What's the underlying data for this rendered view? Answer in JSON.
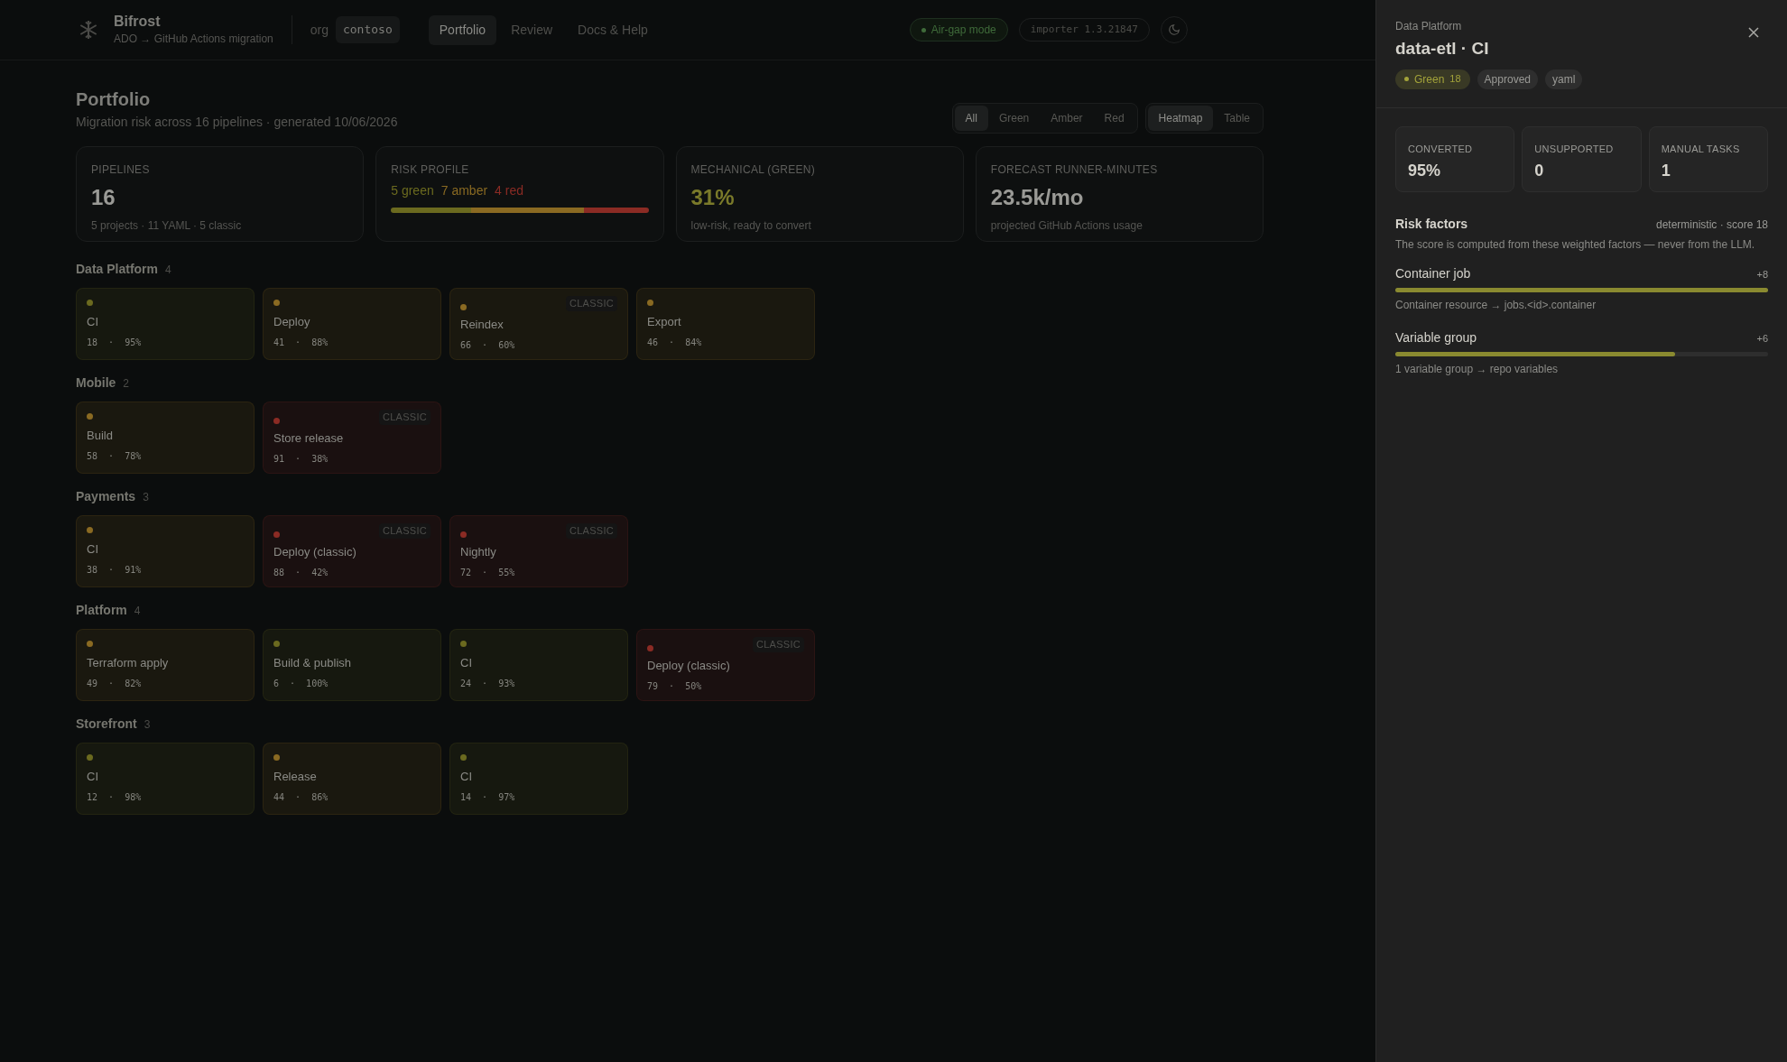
{
  "header": {
    "brand": "Bifrost",
    "subtitle": "ADO → GitHub Actions migration",
    "org_label": "org",
    "org": "contoso",
    "nav": [
      {
        "label": "Portfolio",
        "selected": true
      },
      {
        "label": "Review",
        "selected": false
      },
      {
        "label": "Docs & Help",
        "selected": false
      }
    ],
    "mode_badge": "Air-gap mode",
    "version": "importer 1.3.21847"
  },
  "page": {
    "title": "Portfolio",
    "subtitle": "Migration risk across 16 pipelines · generated 10/06/2026",
    "filters": [
      {
        "label": "All",
        "selected": true
      },
      {
        "label": "Green",
        "selected": false
      },
      {
        "label": "Amber",
        "selected": false
      },
      {
        "label": "Red",
        "selected": false
      }
    ],
    "views": [
      {
        "label": "Heatmap",
        "selected": true
      },
      {
        "label": "Table",
        "selected": false
      }
    ]
  },
  "kpis": [
    {
      "kind": "stat",
      "label": "PIPELINES",
      "value": "16",
      "note": "5 projects · 11 YAML · 5 classic"
    },
    {
      "kind": "profile",
      "label": "RISK PROFILE",
      "segments": [
        {
          "label": "5 green",
          "color": "#6b6a1f"
        },
        {
          "label": "7 amber",
          "color": "#8a6a22"
        },
        {
          "label": "4 red",
          "color": "#8b2b24"
        }
      ]
    },
    {
      "kind": "stat",
      "label": "MECHANICAL (GREEN)",
      "value": "31%",
      "note": "low-risk, ready to convert",
      "color": "#7a7a2a"
    },
    {
      "kind": "stat",
      "label": "FORECAST RUNNER-MINUTES",
      "value": "23.5k/mo",
      "note": "projected GitHub Actions usage"
    }
  ],
  "groups": [
    {
      "name": "Data Platform",
      "count": "4",
      "pipelines": [
        {
          "name": "CI",
          "meta": "18 · 95%",
          "color": "#6b6a1f"
        },
        {
          "name": "Deploy",
          "meta": "41 · 88%",
          "color": "#8a6a22"
        },
        {
          "name": "Reindex",
          "meta": "66 · 60%",
          "color": "#8a6a22",
          "tag": "CLASSIC"
        },
        {
          "name": "Export",
          "meta": "46 · 84%",
          "color": "#8a6a22"
        }
      ]
    },
    {
      "name": "Mobile",
      "count": "2",
      "pipelines": [
        {
          "name": "Build",
          "meta": "58 · 78%",
          "color": "#8a6a22"
        },
        {
          "name": "Store release",
          "meta": "91 · 38%",
          "color": "#8b2b24",
          "tag": "CLASSIC"
        }
      ]
    },
    {
      "name": "Payments",
      "count": "3",
      "pipelines": [
        {
          "name": "CI",
          "meta": "38 · 91%",
          "color": "#8a6a22"
        },
        {
          "name": "Deploy (classic)",
          "meta": "88 · 42%",
          "color": "#8b2b24",
          "tag": "CLASSIC"
        },
        {
          "name": "Nightly",
          "meta": "72 · 55%",
          "color": "#8b2b24",
          "tag": "CLASSIC"
        }
      ]
    },
    {
      "name": "Platform",
      "count": "4",
      "pipelines": [
        {
          "name": "Terraform apply",
          "meta": "49 · 82%",
          "color": "#8a6a22"
        },
        {
          "name": "Build & publish",
          "meta": "6 · 100%",
          "color": "#6b6a1f"
        },
        {
          "name": "CI",
          "meta": "24 · 93%",
          "color": "#6b6a1f"
        },
        {
          "name": "Deploy (classic)",
          "meta": "79 · 50%",
          "color": "#8b2b24",
          "tag": "CLASSIC"
        }
      ]
    },
    {
      "name": "Storefront",
      "count": "3",
      "pipelines": [
        {
          "name": "CI",
          "meta": "12 · 98%",
          "color": "#6b6a1f"
        },
        {
          "name": "Release",
          "meta": "44 · 86%",
          "color": "#8a6a22"
        },
        {
          "name": "CI",
          "meta": "14 · 97%",
          "color": "#6b6a1f"
        }
      ]
    }
  ],
  "panel": {
    "eyebrow": "Data Platform",
    "title": "data-etl · CI",
    "badges": [
      {
        "kind": "risk",
        "label": "Green",
        "score": "18",
        "color": "#a3a33a"
      },
      {
        "kind": "plain",
        "label": "Approved"
      },
      {
        "kind": "plain",
        "label": "yaml"
      }
    ],
    "stats": [
      {
        "label": "CONVERTED",
        "value": "95%"
      },
      {
        "label": "UNSUPPORTED",
        "value": "0"
      },
      {
        "label": "MANUAL TASKS",
        "value": "1"
      }
    ],
    "risk_title": "Risk factors",
    "risk_meta": "deterministic · score 18",
    "risk_note": "The score is computed from these weighted factors — never from the LLM.",
    "factors": [
      {
        "name": "Container job",
        "weight": "+8",
        "level": 1.0,
        "detail": "Container resource → jobs.<id>.container"
      },
      {
        "name": "Variable group",
        "weight": "+6",
        "level": 0.75,
        "detail": "1 variable group → repo variables"
      }
    ]
  }
}
